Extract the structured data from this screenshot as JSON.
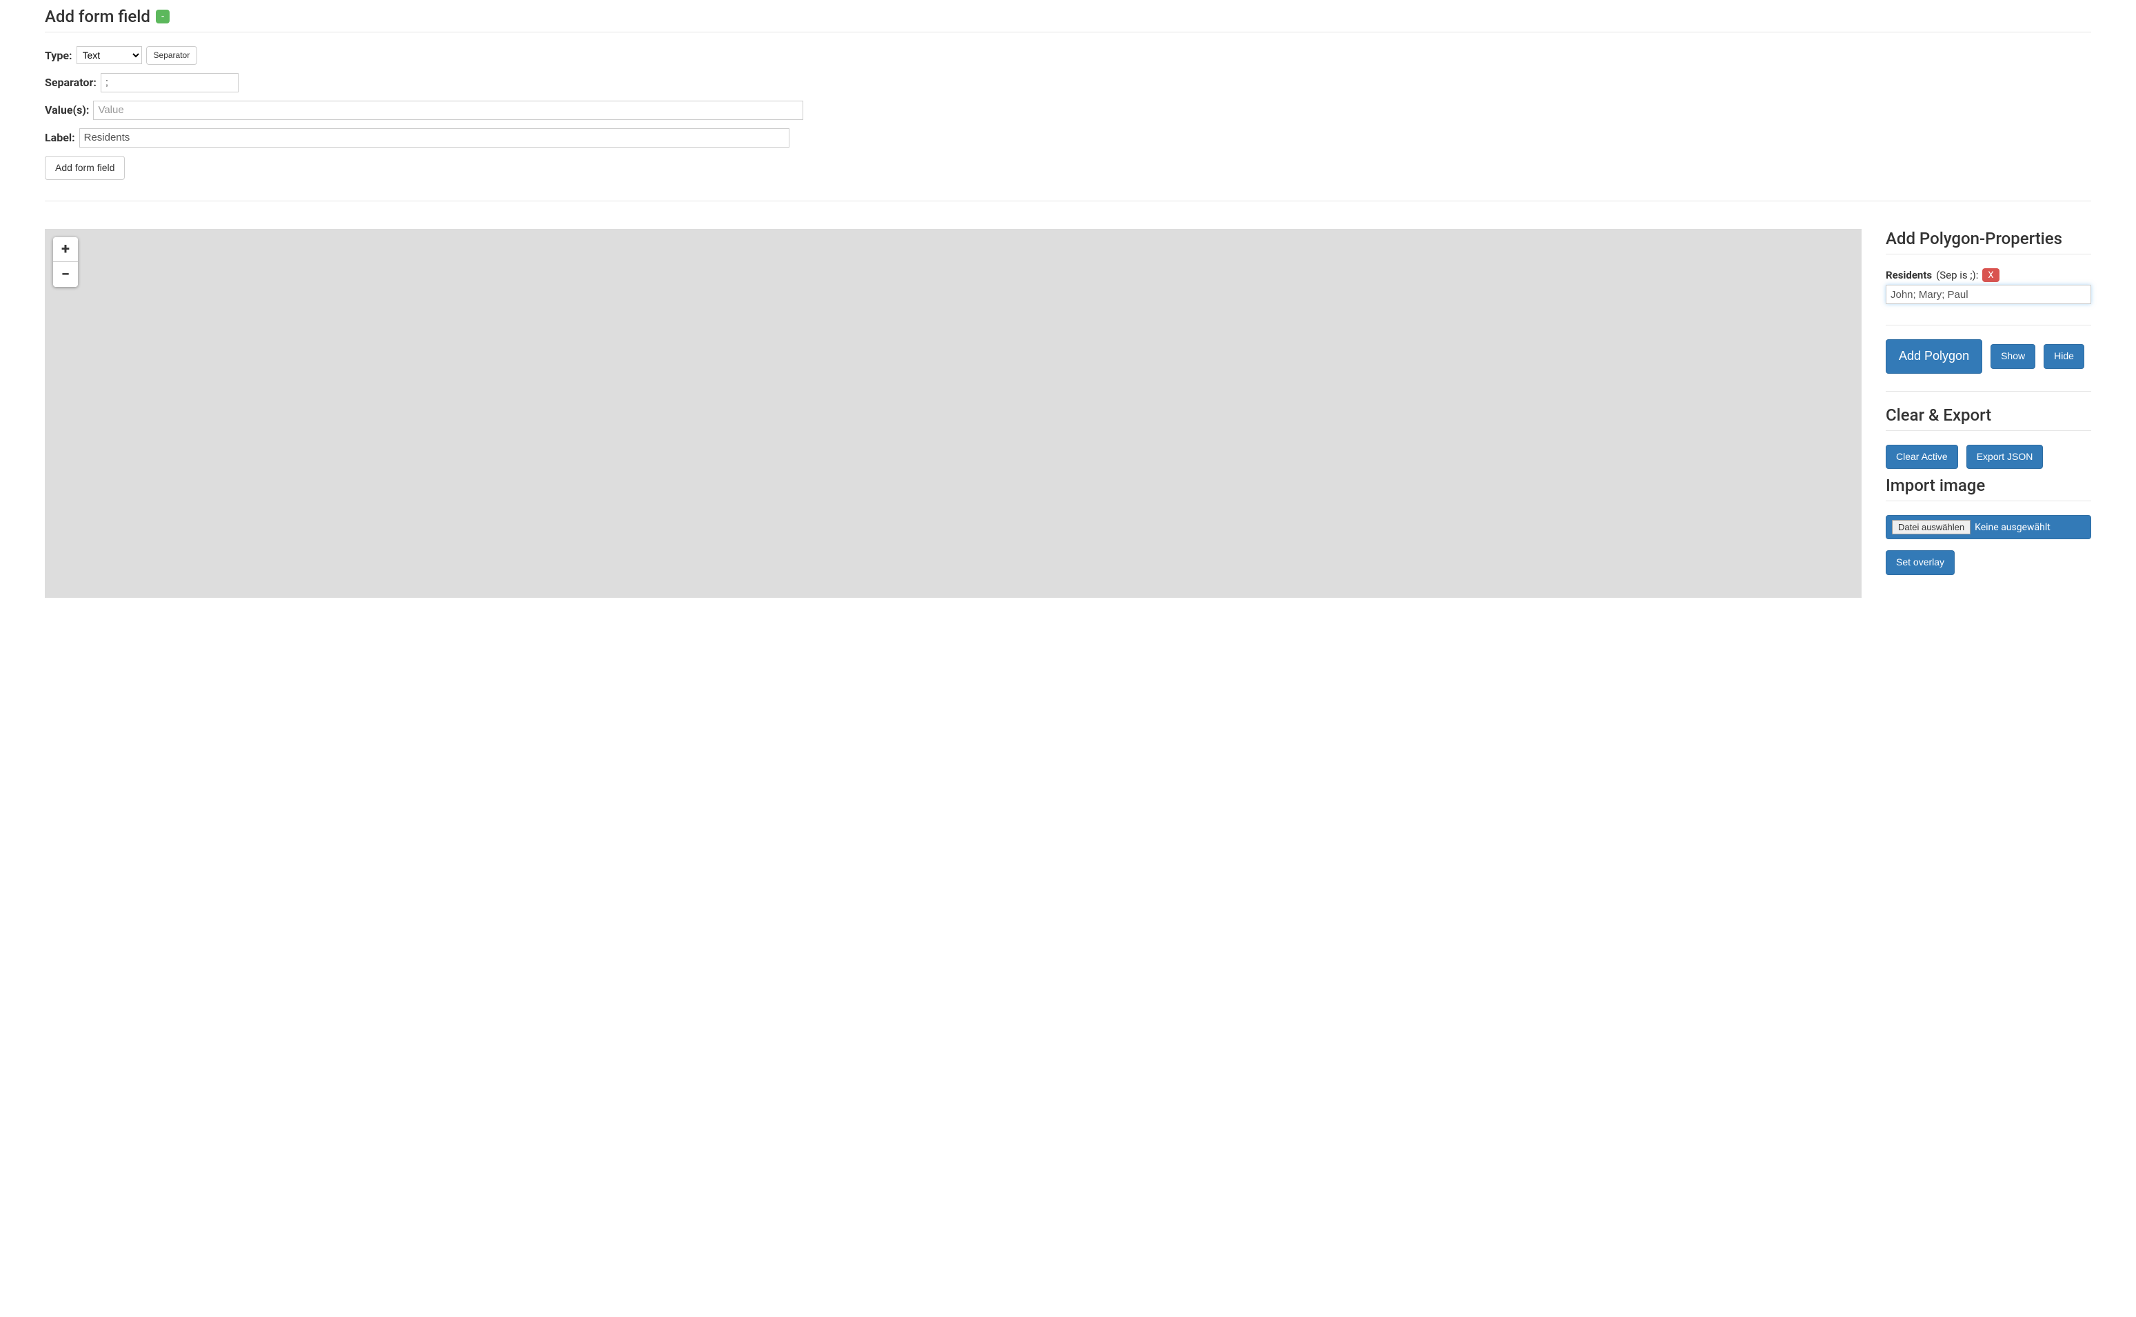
{
  "addFormField": {
    "title": "Add form field",
    "collapseBadge": "-",
    "typeLabel": "Type",
    "typeValue": "Text",
    "typeOptions": [
      "Text"
    ],
    "separatorBtnLabel": "Separator",
    "separatorLabel": "Separator",
    "separatorValue": ";",
    "valuesLabel": "Value(s)",
    "valuesPlaceholder": "Value",
    "valuesValue": "",
    "labelLabel": "Label",
    "labelValue": "Residents",
    "addBtnLabel": "Add form field"
  },
  "map": {
    "zoomInLabel": "+",
    "zoomOutLabel": "−"
  },
  "polygonProps": {
    "title": "Add Polygon-Properties",
    "fieldLabel": "Residents",
    "sepHint": "(Sep is ;):",
    "removeBadge": "X",
    "fieldValue": "John; Mary; Paul",
    "addPolygonBtn": "Add Polygon",
    "showBtn": "Show",
    "hideBtn": "Hide"
  },
  "clearExport": {
    "title": "Clear & Export",
    "clearBtn": "Clear Active",
    "exportBtn": "Export JSON"
  },
  "importImage": {
    "title": "Import image",
    "chooseFileBtn": "Datei auswählen",
    "fileStatus": "Keine ausgewählt",
    "setOverlayBtn": "Set overlay"
  }
}
